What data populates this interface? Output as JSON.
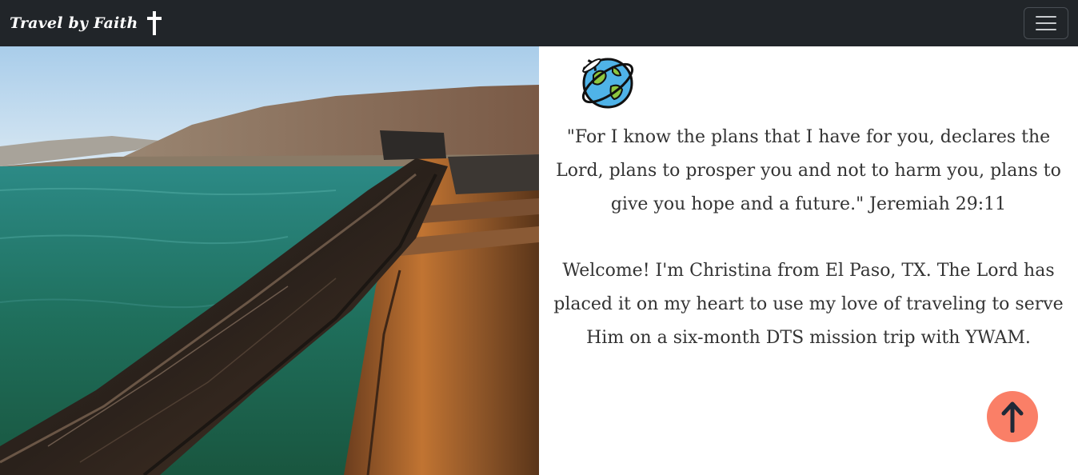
{
  "navbar": {
    "brand": "Travel by Faith",
    "brand_icon": "cross-icon",
    "toggler_icon": "hamburger-menu-icon"
  },
  "hero": {
    "image": "photo of wooden boat bow on the Sea of Galilee"
  },
  "content": {
    "globe_icon": "globe-airplane-icon",
    "verse": "\"For I know the plans that I have for you, declares the Lord, plans to prosper you and not to harm you, plans to give you hope and a future.\" Jeremiah 29:11",
    "welcome": "Welcome! I'm Christina from El Paso, TX. The Lord has placed it on my heart to use my love of traveling to serve Him on a six-month DTS mission trip with YWAM."
  },
  "scroll_top": {
    "icon": "arrow-up-icon",
    "color": "#fa7f67"
  },
  "colors": {
    "navbar_bg": "#212529",
    "text": "#333333",
    "accent": "#fa7f67"
  }
}
